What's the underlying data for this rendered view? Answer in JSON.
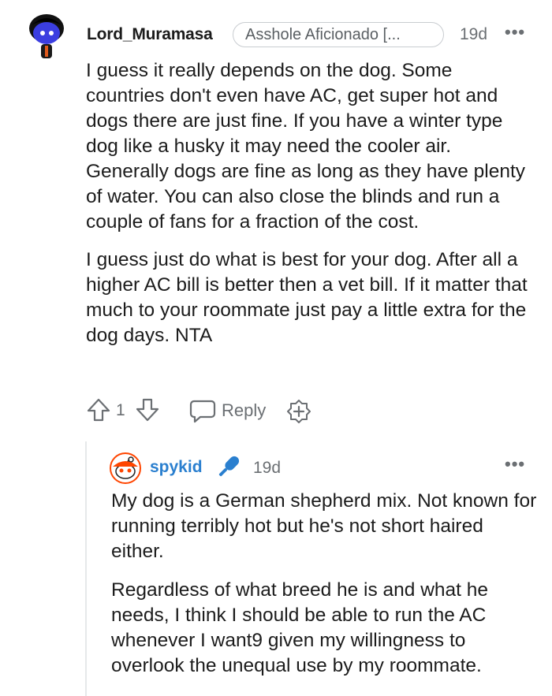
{
  "comment": {
    "username": "Lord_Muramasa",
    "flair": "Asshole Aficionado [...",
    "time": "19d",
    "more": "•••",
    "paragraphs": [
      "I guess it really depends on the dog. Some countries don't even have AC, get super hot and dogs there are just fine. If you have a winter type dog like a husky it may need the cooler air. Generally dogs are fine as long as they have plenty of water. You can also close the blinds and run a couple of fans for a fraction of the cost.",
      "I guess just do what is best for your dog. After all a higher AC bill is better then a vet bill. If it matter that much to your roommate just pay a little extra for the dog days. NTA"
    ],
    "actions": {
      "vote_count": "1",
      "reply_label": "Reply"
    }
  },
  "reply": {
    "username": "spykid",
    "time": "19d",
    "more": "•••",
    "paragraphs": [
      "My dog is a German shepherd mix. Not known for running terribly hot but he's not short haired either.",
      "Regardless of what breed he is and what he needs, I think I should be able to run the AC whenever I want9 given my willingness to overlook the unequal use by my roommate."
    ]
  },
  "colors": {
    "username_blue": "#2a7fcf",
    "meta_gray": "#6b6f73",
    "text": "#1c1c1c"
  },
  "icons": [
    "avatar-snoo",
    "upvote-icon",
    "downvote-icon",
    "reply-bubble-icon",
    "award-plus-icon",
    "microphone-icon",
    "more-options-icon"
  ]
}
